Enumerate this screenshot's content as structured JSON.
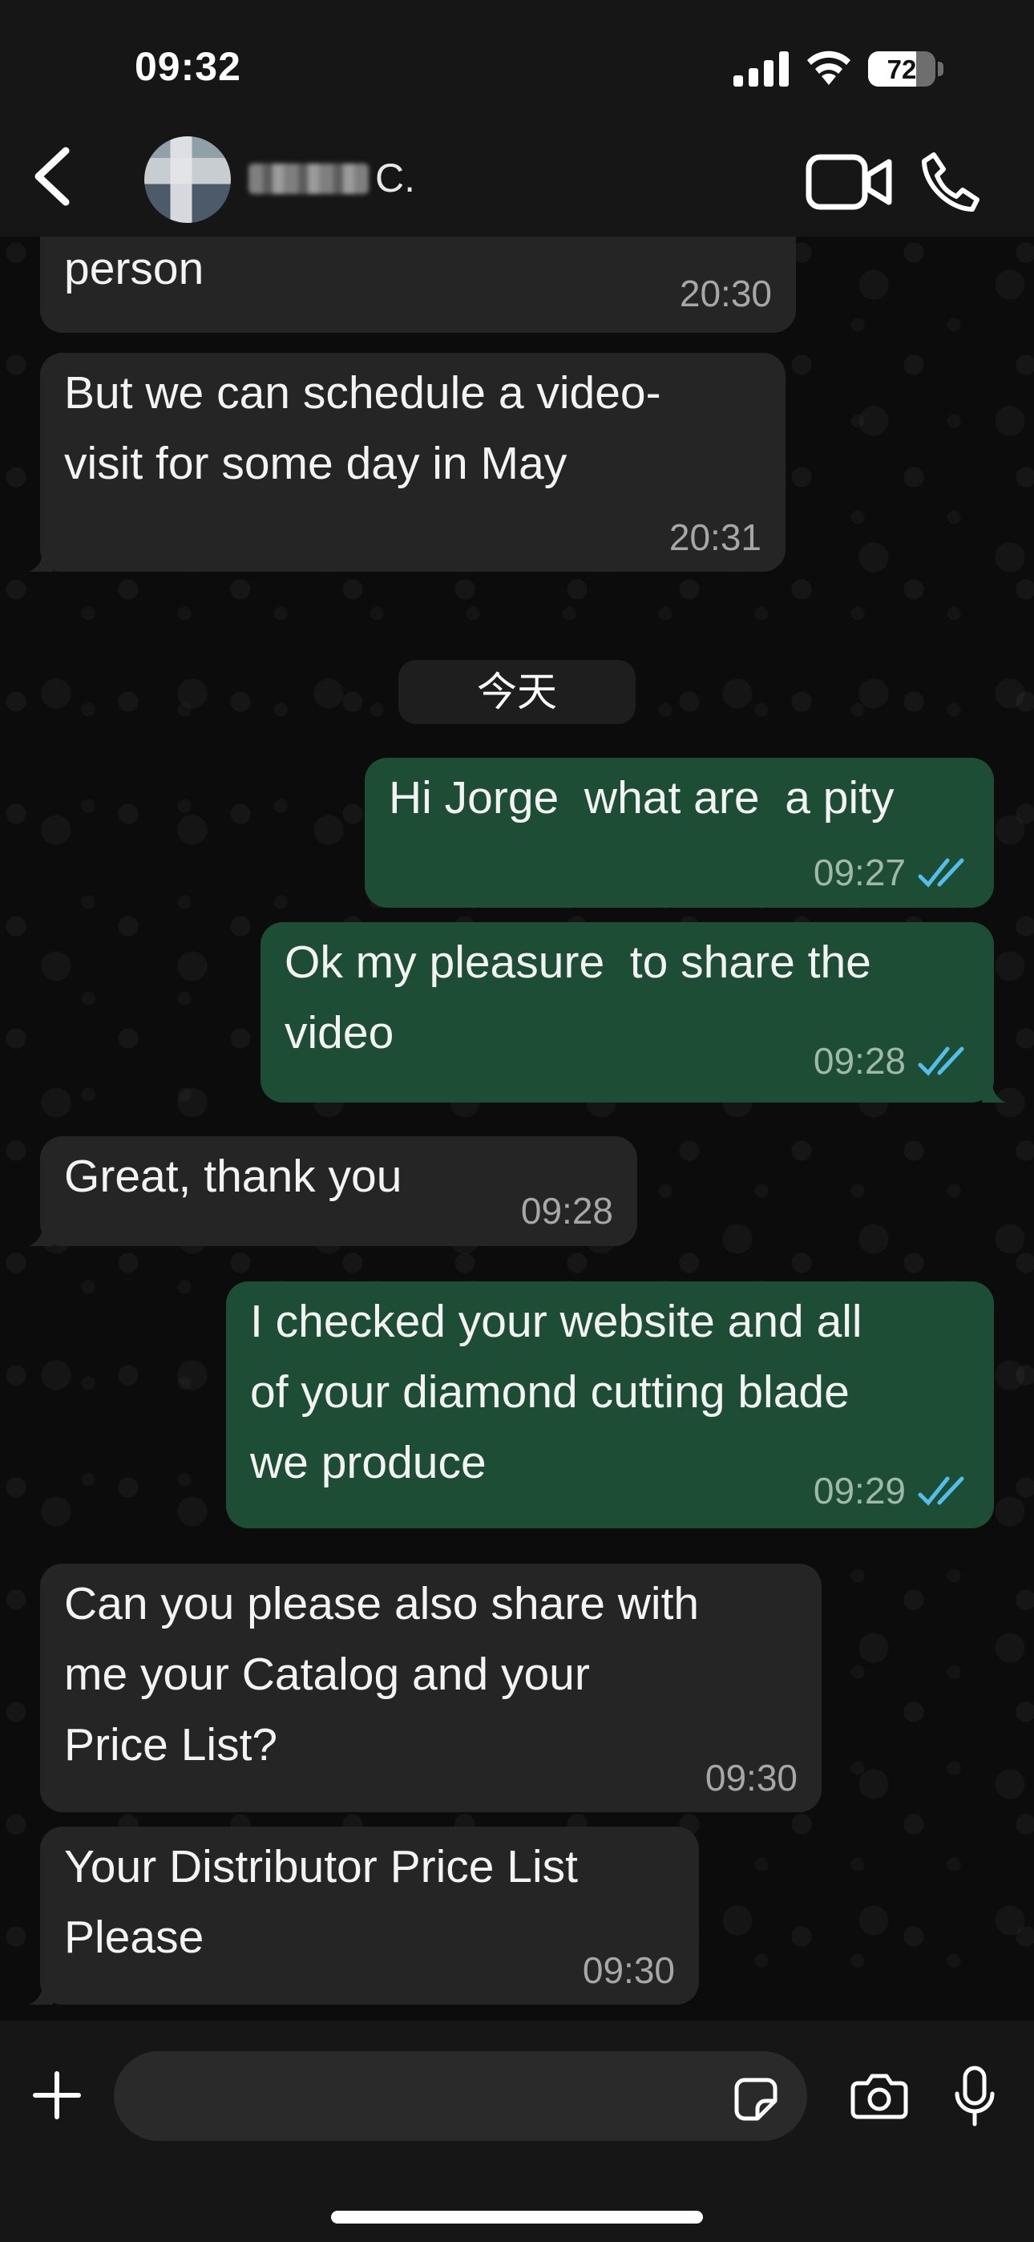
{
  "status_bar": {
    "time": "09:32",
    "battery_percent": "72",
    "battery_level": 0.72
  },
  "header": {
    "contact_name_visible": "C."
  },
  "chat": {
    "date_separator": "今天",
    "messages": [
      {
        "direction": "incoming",
        "text": "person",
        "time": "20:30"
      },
      {
        "direction": "incoming",
        "text": "But we can schedule a video-\nvisit for some day in May",
        "time": "20:31"
      },
      {
        "direction": "outgoing",
        "text": "Hi Jorge  what are  a pity",
        "time": "09:27",
        "status": "read"
      },
      {
        "direction": "outgoing",
        "text": "Ok my pleasure  to share the\nvideo",
        "time": "09:28",
        "status": "read"
      },
      {
        "direction": "incoming",
        "text": "Great, thank you",
        "time": "09:28"
      },
      {
        "direction": "outgoing",
        "text": "I checked your website and all\nof your diamond cutting blade\nwe produce",
        "time": "09:29",
        "status": "read"
      },
      {
        "direction": "incoming",
        "text": "Can you please also share with\nme your Catalog and your\nPrice List?",
        "time": "09:30"
      },
      {
        "direction": "incoming",
        "text": "Your Distributor Price List\nPlease",
        "time": "09:30"
      }
    ]
  },
  "composer": {
    "value": ""
  },
  "colors": {
    "incoming_bubble": "#252525",
    "outgoing_bubble": "#1d4d34",
    "read_ticks": "#53bdeb",
    "background": "#0b0b0b"
  }
}
